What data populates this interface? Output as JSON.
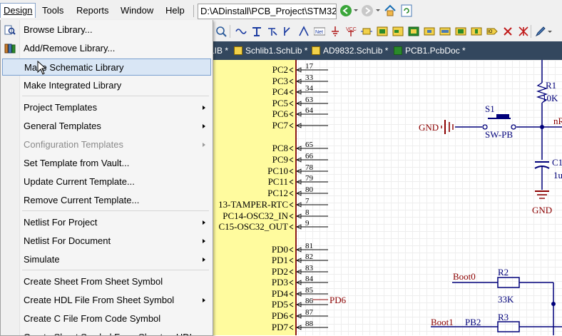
{
  "menubar": {
    "items": [
      "Design",
      "Tools",
      "Reports",
      "Window",
      "Help"
    ],
    "path": "D:\\ADinstall\\PCB_Project\\STM32"
  },
  "tabs": [
    {
      "label": "LIB *"
    },
    {
      "label": "Schlib1.SchLib *"
    },
    {
      "label": "AD9832.SchLib *"
    },
    {
      "label": "PCB1.PcbDoc *"
    }
  ],
  "dropdown": {
    "items": [
      {
        "label": "Browse Library...",
        "icon": "browse-library-icon"
      },
      {
        "label": "Add/Remove Library...",
        "icon": "add-remove-library-icon"
      },
      {
        "label": "Make Schematic Library",
        "highlighted": true
      },
      {
        "label": "Make Integrated Library"
      },
      {
        "label": "Project Templates",
        "submenu": true
      },
      {
        "label": "General Templates",
        "submenu": true
      },
      {
        "label": "Configuration Templates",
        "submenu": true,
        "disabled": true
      },
      {
        "label": "Set Template from Vault..."
      },
      {
        "label": "Update Current Template..."
      },
      {
        "label": "Remove Current Template..."
      },
      {
        "label": "Netlist For Project",
        "submenu": true
      },
      {
        "label": "Netlist For Document",
        "submenu": true
      },
      {
        "label": "Simulate",
        "submenu": true
      },
      {
        "label": "Create Sheet From Sheet Symbol"
      },
      {
        "label": "Create HDL File From Sheet Symbol",
        "submenu": true
      },
      {
        "label": "Create C File From Code Symbol"
      },
      {
        "label": "Create Sheet Symbol From Sheet or HDL"
      }
    ]
  },
  "schematic": {
    "pins": [
      {
        "name": "PC2",
        "num": "17"
      },
      {
        "name": "PC3",
        "num": "33"
      },
      {
        "name": "PC4",
        "num": "34"
      },
      {
        "name": "PC5",
        "num": "63"
      },
      {
        "name": "PC6",
        "num": "64"
      },
      {
        "name": "PC7",
        "num": ""
      },
      {
        "name": "PC8",
        "num": "65"
      },
      {
        "name": "PC9",
        "num": "66"
      },
      {
        "name": "PC10",
        "num": "78"
      },
      {
        "name": "PC11",
        "num": "79"
      },
      {
        "name": "PC12",
        "num": "80"
      },
      {
        "name": "13-TAMPER-RTC",
        "num": "7"
      },
      {
        "name": "PC14-OSC32_IN",
        "num": "8"
      },
      {
        "name": "C15-OSC32_OUT",
        "num": "9"
      },
      {
        "name": "PD0",
        "num": "81"
      },
      {
        "name": "PD1",
        "num": "82"
      },
      {
        "name": "PD2",
        "num": "83"
      },
      {
        "name": "PD3",
        "num": "84"
      },
      {
        "name": "PD4",
        "num": "85"
      },
      {
        "name": "PD5",
        "num": "86"
      },
      {
        "name": "PD6",
        "num": "87"
      },
      {
        "name": "PD7",
        "num": "88"
      }
    ],
    "net_pd6": "PD6",
    "r1_ref": "R1",
    "r1_val": "10K",
    "s1_ref": "S1",
    "s1_val": "SW-PB",
    "gnd_left": "GND",
    "gnd_bottom": "GND",
    "c1_ref": "C1",
    "c1_val": "1u",
    "net_right": "nR",
    "boot0": "Boot0",
    "r2_ref": "R2",
    "r2_val": "33K",
    "boot1": "Boot1",
    "pb2": "PB2",
    "r3_ref": "R3"
  },
  "colors": {
    "accent": "#33475e",
    "wire": "#00007a",
    "net": "#8b0000",
    "chip_fill": "#fffb9e"
  }
}
